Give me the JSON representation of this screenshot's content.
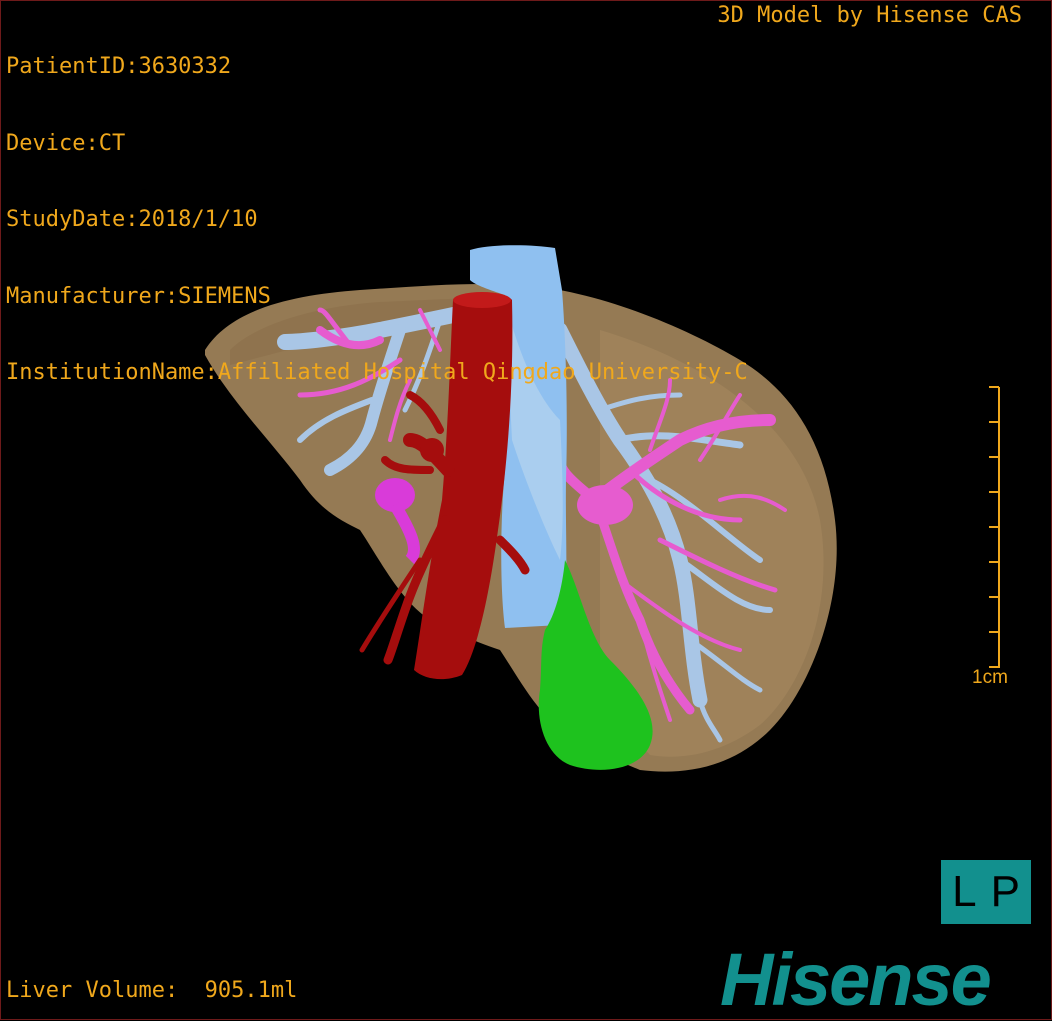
{
  "overlay": {
    "patient_id": "PatientID:3630332",
    "device": "Device:CT",
    "study_date": "StudyDate:2018/1/10",
    "manufacturer": "Manufacturer:SIEMENS",
    "institution": "InstitutionName:Affiliated Hospital Qingdao University-C",
    "credit": "3D Model by Hisense CAS",
    "liver_volume": "Liver Volume:  905.1ml"
  },
  "scale_bar": {
    "label": "1cm"
  },
  "orientation": {
    "left": "L",
    "right": "P"
  },
  "logo": {
    "text": "Hisense"
  },
  "colors": {
    "text": "#f0a81c",
    "liver": "#a0835a",
    "portal_vein": "#e65ccf",
    "hepatic_vein": "#a9c6e6",
    "ivc": "#8fc0f0",
    "aorta": "#a50d0d",
    "gallbladder": "#1ec21e",
    "brand": "#12908e"
  }
}
